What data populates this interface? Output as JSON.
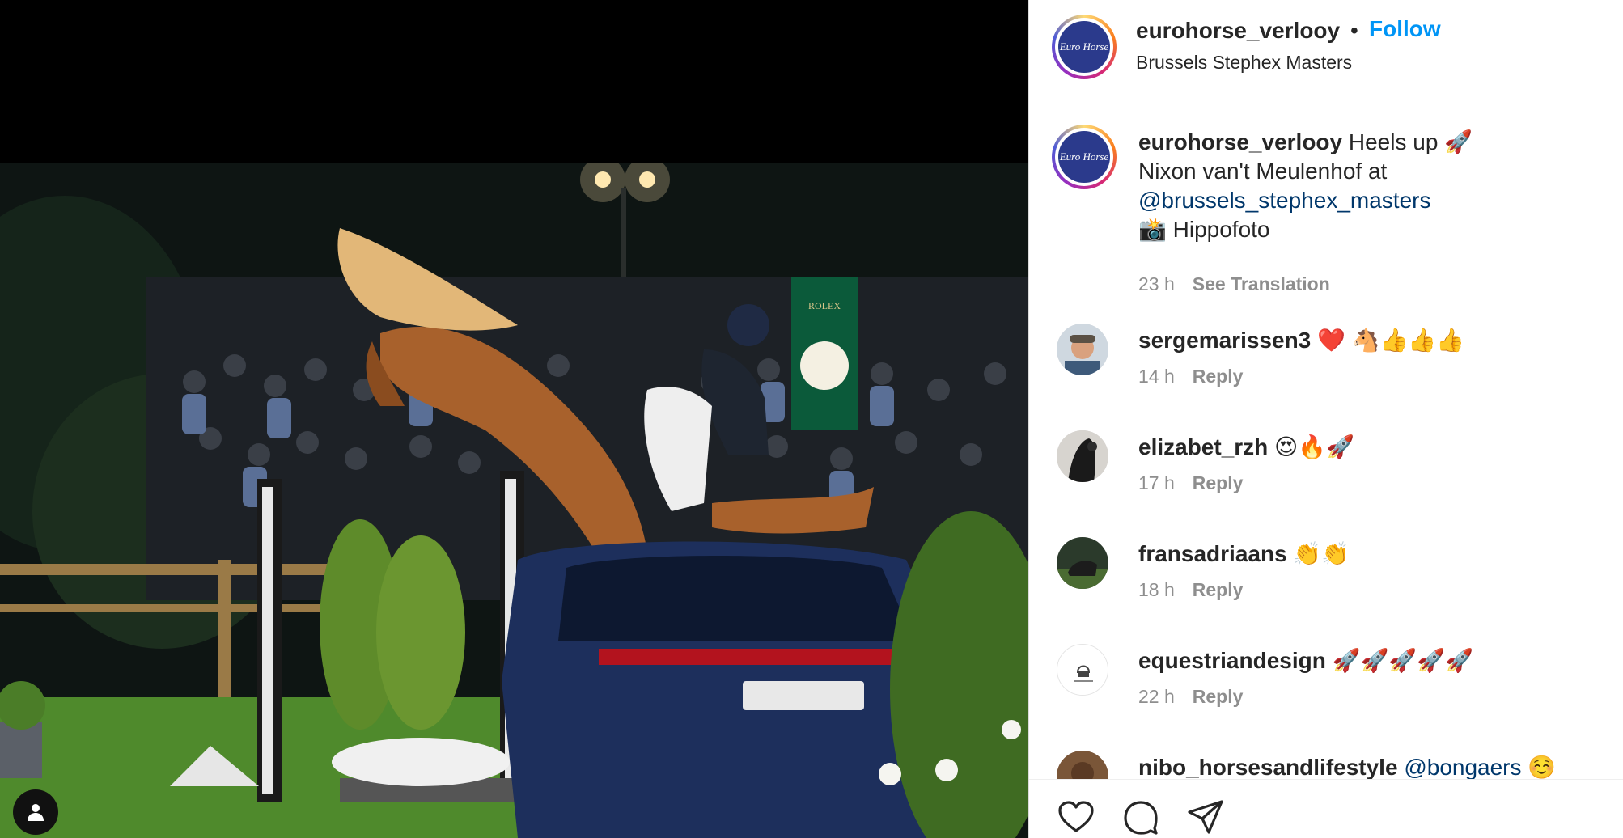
{
  "post": {
    "account": "eurohorse_verlooy",
    "separator": "•",
    "follow_label": "Follow",
    "location": "Brussels Stephex Masters",
    "avatar_text": "Euro Horse"
  },
  "caption": {
    "user": "eurohorse_verlooy",
    "text_line1": " Heels up 🚀",
    "text_line2": "Nixon van't Meulenhof at",
    "mention": "@brussels_stephex_masters",
    "text_line4": "📸 Hippofoto",
    "time": "23 h",
    "see_translation": "See Translation"
  },
  "comments": [
    {
      "user": "sergemarissen3",
      "text": " ❤️ 🐴👍👍👍",
      "time": "14 h",
      "reply": "Reply"
    },
    {
      "user": "elizabet_rzh",
      "text": " 😍🔥🚀",
      "time": "17 h",
      "reply": "Reply"
    },
    {
      "user": "fransadriaans",
      "text": " 👏👏",
      "time": "18 h",
      "reply": "Reply"
    },
    {
      "user": "equestriandesign",
      "text": " 🚀🚀🚀🚀🚀",
      "time": "22 h",
      "reply": "Reply"
    },
    {
      "user": "nibo_horsesandlifestyle",
      "mention": "@bongaers",
      "text": " ☺️"
    }
  ],
  "photo_signs": {
    "rolex": "ROLEX"
  },
  "icons": {
    "like": "heart-icon",
    "comment": "comment-bubble-icon",
    "share": "paper-plane-icon",
    "tags": "user-tag-icon"
  }
}
